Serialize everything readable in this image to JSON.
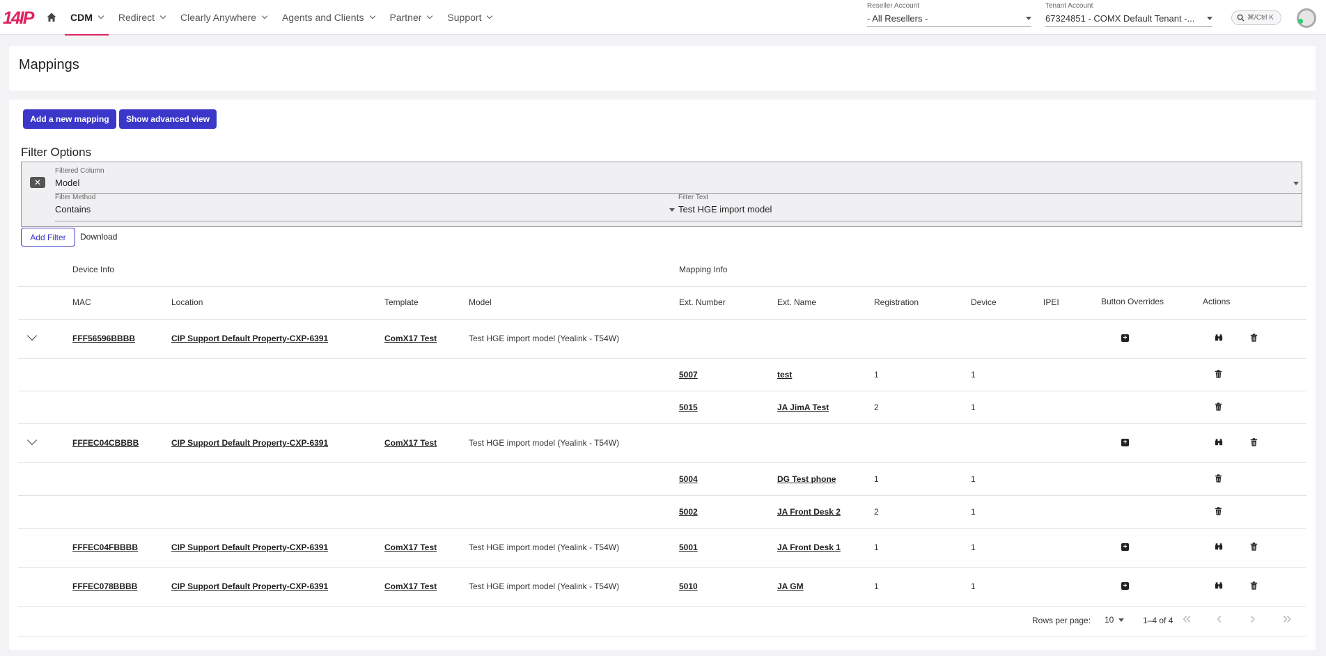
{
  "brand": {
    "logo_text": "14IP"
  },
  "nav": {
    "items": [
      {
        "label": "CDM",
        "active": true
      },
      {
        "label": "Redirect"
      },
      {
        "label": "Clearly Anywhere"
      },
      {
        "label": "Agents and Clients"
      },
      {
        "label": "Partner"
      },
      {
        "label": "Support"
      }
    ]
  },
  "reseller": {
    "label": "Reseller Account",
    "value": "-  All Resellers -"
  },
  "tenant": {
    "label": "Tenant Account",
    "value": "67324851 - COMX Default Tenant -..."
  },
  "search": {
    "shortcut": "⌘/Ctrl K"
  },
  "page": {
    "title": "Mappings"
  },
  "actions": {
    "add_mapping": "Add a new mapping",
    "advanced_view": "Show advanced view"
  },
  "filters": {
    "title": "Filter Options",
    "column_label": "Filtered Column",
    "column_value": "Model",
    "method_label": "Filter Method",
    "method_value": "Contains",
    "text_label": "Filter Text",
    "text_value": "Test HGE import model",
    "add_filter": "Add Filter",
    "download": "Download"
  },
  "table": {
    "group_headers": {
      "device": "Device Info",
      "mapping": "Mapping Info"
    },
    "columns": [
      "MAC",
      "Location",
      "Template",
      "Model",
      "Ext. Number",
      "Ext. Name",
      "Registration",
      "Device",
      "IPEI",
      "Button Overrides",
      "Actions"
    ],
    "rows": [
      {
        "type": "device",
        "expand": true,
        "mac": "FFF56596BBBB",
        "location": "CIP Support Default Property-CXP-6391",
        "template": "ComX17 Test",
        "model": "Test HGE import model (Yealink - T54W)"
      },
      {
        "type": "sub",
        "ext_number": "5007",
        "ext_name": "test",
        "registration": "1",
        "device": "1"
      },
      {
        "type": "sub",
        "ext_number": "5015",
        "ext_name": "JA JimA Test",
        "registration": "2",
        "device": "1"
      },
      {
        "type": "device",
        "expand": true,
        "mac": "FFFEC04CBBBB",
        "location": "CIP Support Default Property-CXP-6391",
        "template": "ComX17 Test",
        "model": "Test HGE import model (Yealink - T54W)"
      },
      {
        "type": "sub",
        "ext_number": "5004",
        "ext_name": "DG Test phone",
        "registration": "1",
        "device": "1"
      },
      {
        "type": "sub",
        "ext_number": "5002",
        "ext_name": "JA Front Desk 2",
        "registration": "2",
        "device": "1"
      },
      {
        "type": "device",
        "expand": false,
        "mac": "FFFEC04FBBBB",
        "location": "CIP Support Default Property-CXP-6391",
        "template": "ComX17 Test",
        "model": "Test HGE import model (Yealink - T54W)",
        "ext_number": "5001",
        "ext_name": "JA Front Desk 1",
        "registration": "1",
        "device": "1"
      },
      {
        "type": "device",
        "expand": false,
        "mac": "FFFEC078BBBB",
        "location": "CIP Support Default Property-CXP-6391",
        "template": "ComX17 Test",
        "model": "Test HGE import model (Yealink - T54W)",
        "ext_number": "5010",
        "ext_name": "JA GM",
        "registration": "1",
        "device": "1"
      }
    ]
  },
  "pagination": {
    "rows_label": "Rows per page:",
    "rows_value": "10",
    "range": "1–4 of 4"
  },
  "icons": {
    "home": "home-icon",
    "search": "search-icon",
    "override": "plus-square-icon",
    "view": "binoculars-icon",
    "delete": "trash-icon"
  },
  "colors": {
    "brand": "#e0245e",
    "primary": "#3b37c9"
  }
}
